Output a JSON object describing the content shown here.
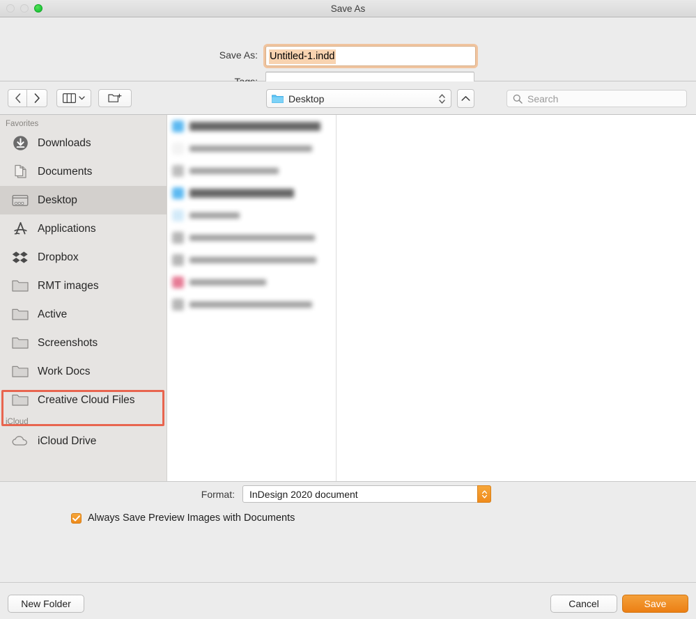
{
  "window": {
    "title": "Save As",
    "traffic_lights": [
      "close-disabled",
      "minimize-disabled",
      "zoom-green"
    ]
  },
  "header": {
    "saveas_label": "Save As:",
    "filename_value": "Untitled-1.indd",
    "tags_label": "Tags:",
    "tags_value": "",
    "tags_placeholder": ""
  },
  "toolbar": {
    "back_icon": "chevron-left-icon",
    "forward_icon": "chevron-right-icon",
    "view_icon": "column-view-icon",
    "view_chevron": "chevron-down-icon",
    "new_folder_icon": "new-folder-icon",
    "path_label": "Desktop",
    "path_icon": "blue-folder-icon",
    "up_icon": "chevron-up-icon",
    "search_placeholder": "Search",
    "search_value": "",
    "search_icon": "search-icon"
  },
  "sidebar": {
    "sections": [
      {
        "header": "Favorites",
        "items": [
          {
            "label": "Downloads",
            "icon": "downloads-icon",
            "selected": false,
            "highlighted": false
          },
          {
            "label": "Documents",
            "icon": "documents-icon",
            "selected": false,
            "highlighted": false
          },
          {
            "label": "Desktop",
            "icon": "desktop-icon",
            "selected": true,
            "highlighted": false
          },
          {
            "label": "Applications",
            "icon": "applications-icon",
            "selected": false,
            "highlighted": false
          },
          {
            "label": "Dropbox",
            "icon": "dropbox-icon",
            "selected": false,
            "highlighted": false
          },
          {
            "label": "RMT images",
            "icon": "folder-icon",
            "selected": false,
            "highlighted": false
          },
          {
            "label": "Active",
            "icon": "folder-icon",
            "selected": false,
            "highlighted": false
          },
          {
            "label": "Screenshots",
            "icon": "folder-icon",
            "selected": false,
            "highlighted": false
          },
          {
            "label": "Work Docs",
            "icon": "folder-icon",
            "selected": false,
            "highlighted": false
          },
          {
            "label": "Creative Cloud Files",
            "icon": "folder-icon",
            "selected": false,
            "highlighted": true
          }
        ]
      },
      {
        "header": "iCloud",
        "items": [
          {
            "label": "iCloud Drive",
            "icon": "cloud-icon",
            "selected": false,
            "highlighted": false
          }
        ]
      }
    ]
  },
  "annotation": {
    "target": "Creative Cloud Files",
    "color": "#e8654f",
    "shape": "rectangle"
  },
  "file_list": {
    "obscured": true,
    "note": "file names blurred/redacted",
    "rows": [
      {
        "icon_color": "#4fb3f0",
        "name_width": 188,
        "emphasis": "big"
      },
      {
        "icon_color": "#f2f2f2",
        "name_width": 176,
        "emphasis": "small"
      },
      {
        "icon_color": "#b8b8b8",
        "name_width": 128,
        "emphasis": "small"
      },
      {
        "icon_color": "#4fb3f0",
        "name_width": 150,
        "emphasis": "big"
      },
      {
        "icon_color": "#cfe8f8",
        "name_width": 72,
        "emphasis": "small"
      },
      {
        "icon_color": "#b0b0b0",
        "name_width": 180,
        "emphasis": "small"
      },
      {
        "icon_color": "#b0b0b0",
        "name_width": 182,
        "emphasis": "small"
      },
      {
        "icon_color": "#e4708c",
        "name_width": 110,
        "emphasis": "small"
      },
      {
        "icon_color": "#b0b0b0",
        "name_width": 176,
        "emphasis": "small"
      }
    ]
  },
  "format": {
    "label": "Format:",
    "value": "InDesign 2020 document",
    "stepper_icon": "stepper-arrows-icon",
    "stepper_color": "#ef8b1c"
  },
  "preview_option": {
    "label": "Always Save Preview Images with Documents",
    "checked": true,
    "check_color": "#ee8a1b"
  },
  "buttons": {
    "new_folder": "New Folder",
    "cancel": "Cancel",
    "save": "Save",
    "save_color": "#ec7f14"
  }
}
